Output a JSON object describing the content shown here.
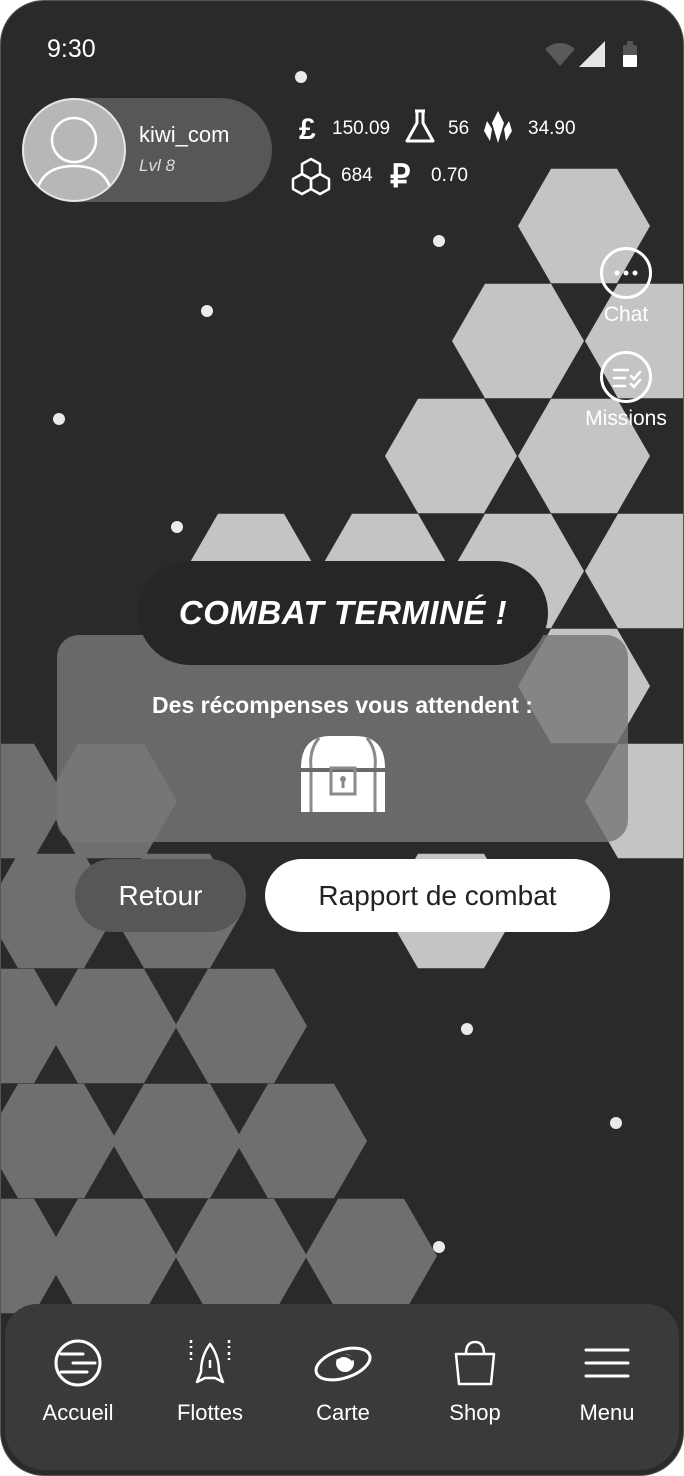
{
  "status_bar": {
    "time": "9:30"
  },
  "profile": {
    "username": "kiwi_com",
    "level": "Lvl 8"
  },
  "resources": {
    "pounds": "150.09",
    "potion": "56",
    "crystals": "34.90",
    "cubes": "684",
    "rubles": "0.70"
  },
  "side_actions": {
    "chat_label": "Chat",
    "missions_label": "Missions"
  },
  "dialog": {
    "title": "COMBAT TERMINÉ !",
    "message": "Des récompenses vous attendent :",
    "back_label": "Retour",
    "report_label": "Rapport de combat"
  },
  "nav": {
    "items": [
      {
        "label": "Accueil",
        "icon": "planet-icon"
      },
      {
        "label": "Flottes",
        "icon": "rocket-icon"
      },
      {
        "label": "Carte",
        "icon": "galaxy-icon"
      },
      {
        "label": "Shop",
        "icon": "shopping-bag-icon"
      },
      {
        "label": "Menu",
        "icon": "hamburger-menu-icon"
      }
    ]
  },
  "colors": {
    "background": "#2a2a2a",
    "hex_light": "#c4c4c4",
    "hex_dark": "#6f6f6f",
    "pill": "#575757"
  }
}
